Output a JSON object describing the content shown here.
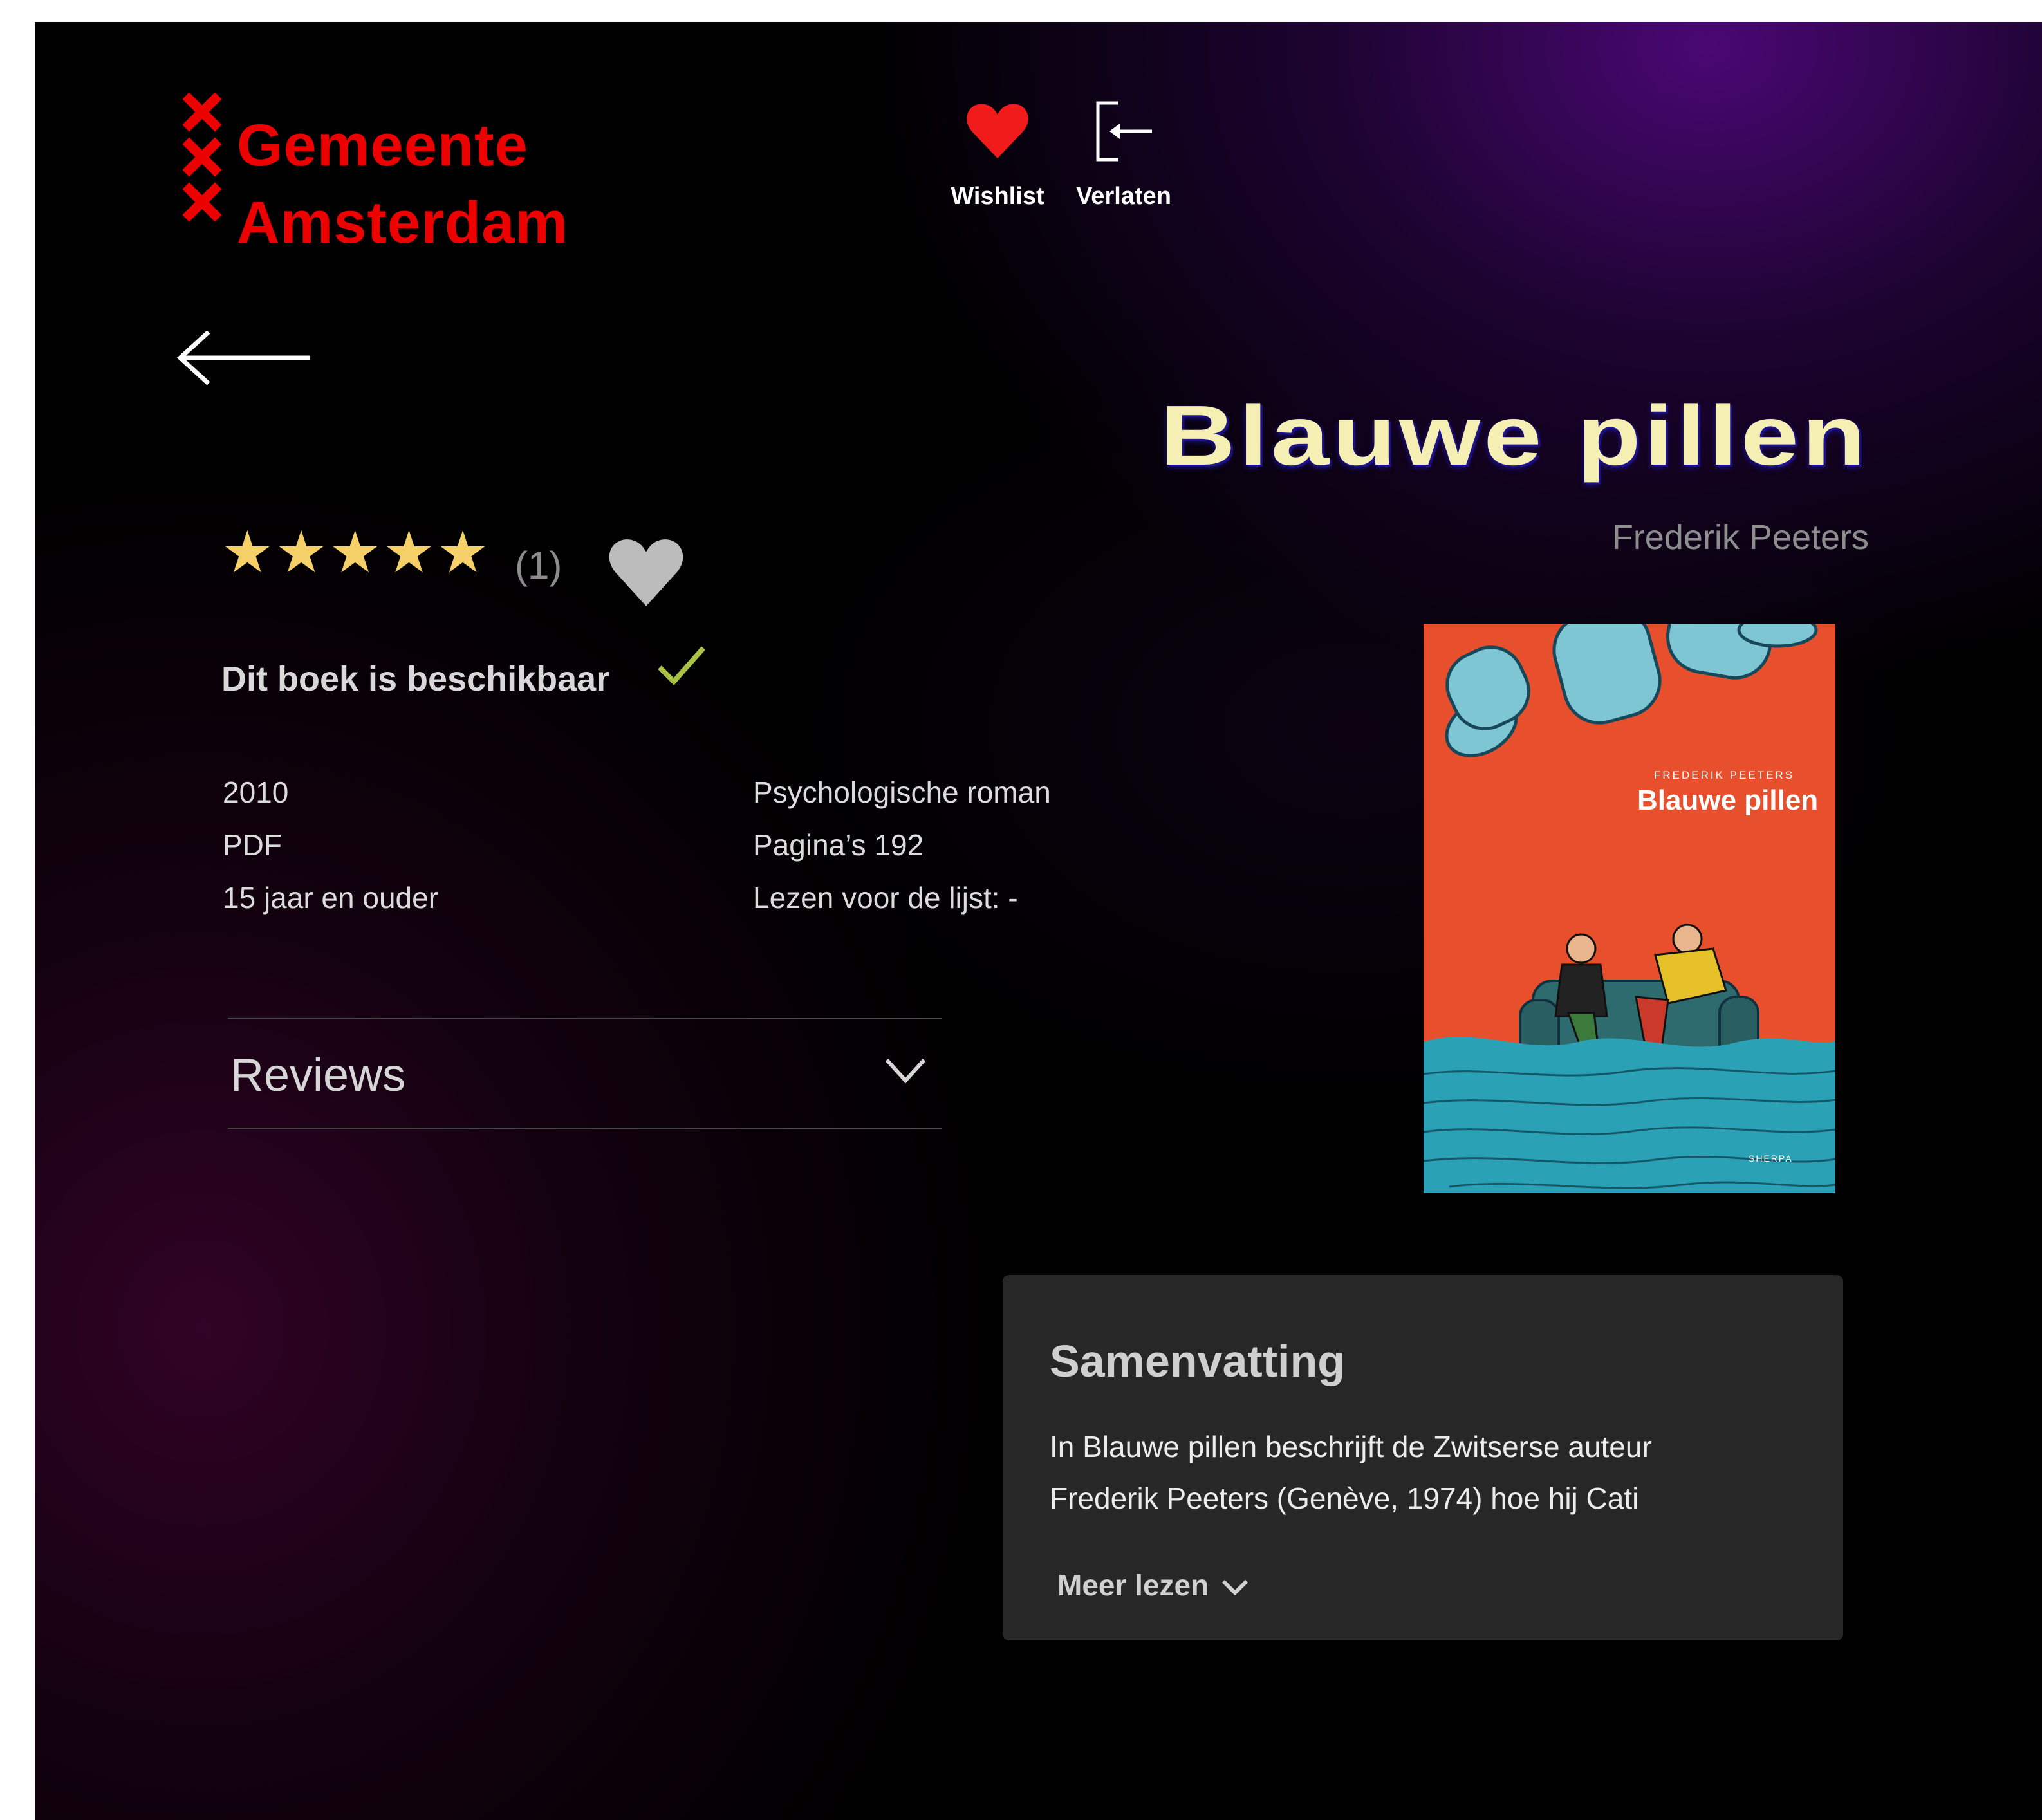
{
  "header": {
    "logo": {
      "line1": "Gemeente",
      "line2": "Amsterdam"
    },
    "nav": [
      {
        "label": "Wishlist",
        "icon": "heart-icon"
      },
      {
        "label": "Verlaten",
        "icon": "exit-icon"
      }
    ]
  },
  "back": {
    "icon": "arrow-left-icon"
  },
  "book": {
    "title": "Blauwe pillen",
    "author": "Frederik Peeters",
    "rating": {
      "stars": 5,
      "max": 5,
      "star_glyph": "★",
      "count_label": "(1)"
    },
    "availability": "Dit boek is beschikbaar",
    "meta_left": [
      "2010",
      "PDF",
      "15 jaar en ouder"
    ],
    "meta_right": [
      "Psychologische roman",
      "Pagina’s 192",
      "Lezen voor de lijst: -"
    ],
    "cover": {
      "author": "FREDERIK PEETERS",
      "title": "Blauwe pillen",
      "publisher": "SHERPA"
    }
  },
  "reviews": {
    "label": "Reviews"
  },
  "summary": {
    "title": "Samenvatting",
    "lines": [
      "In Blauwe pillen beschrijft de Zwitserse auteur",
      "Frederik Peeters (Genève, 1974) hoe hij Cati"
    ],
    "more_label": "Meer lezen"
  },
  "colors": {
    "logo_red": "#ec0000",
    "nav_heart": "#f21b1b",
    "title": "#f6efb3",
    "star": "#f5cf68",
    "check": "#a7c244",
    "cover_orange": "#e8502d",
    "cover_sea": "#2aa1b4",
    "summary_bg": "#272727"
  }
}
